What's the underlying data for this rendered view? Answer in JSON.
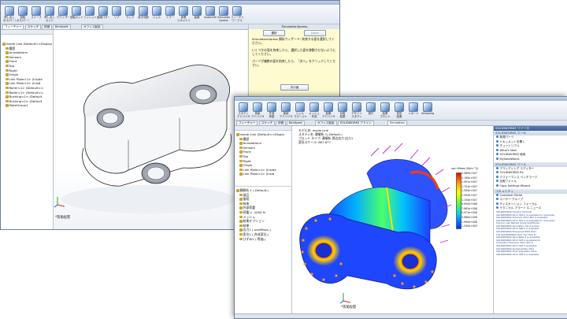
{
  "back_window": {
    "ribbon": [
      {
        "label": "押し出し\nボス/ベース",
        "icon": "extrude-boss-icon"
      },
      {
        "label": "回転\nボス/ベース",
        "icon": "revolve-boss-icon"
      },
      {
        "label": "スイープ",
        "icon": "sweep-icon"
      },
      {
        "label": "押し出し\nカット",
        "icon": "extrude-cut-icon"
      },
      {
        "label": "穴ウィザード",
        "icon": "hole-wizard-icon"
      },
      {
        "label": "回転カット",
        "icon": "revolve-cut-icon"
      },
      {
        "label": "フィレット",
        "icon": "fillet-icon"
      },
      {
        "label": "直線パターン",
        "icon": "linear-pattern-icon"
      },
      {
        "label": "リブ",
        "icon": "rib-icon"
      },
      {
        "label": "ラップ",
        "icon": "wrap-icon"
      },
      {
        "label": "抜き勾配",
        "icon": "draft-icon"
      },
      {
        "label": "シェル",
        "icon": "shell-icon"
      },
      {
        "label": "ミラー",
        "icon": "mirror-icon"
      },
      {
        "label": "参照\nジオメトリ",
        "icon": "ref-geometry-icon"
      },
      {
        "label": "曲線",
        "icon": "curves-icon"
      },
      {
        "label": "Instant3D",
        "icon": "instant3d-icon"
      },
      {
        "label": "Simulation\nXpress",
        "icon": "simxpress-icon"
      },
      {
        "label": "フィーチャー\nワークス",
        "icon": "featureworks-icon"
      }
    ],
    "tabs": [
      "フィーチャー",
      "スケッチ",
      "評価",
      "DimXpert",
      "オフィス製品"
    ],
    "active_tab": 0,
    "tree": [
      "Inside Link (Default<<Display",
      "履歴",
      "Annotations",
      "Sensors",
      "Front",
      "Top",
      "Right",
      "Origin",
      "Link Plate<1> (Inside",
      "Link Plate<2> (Insid",
      "Roller<1> (Default<<",
      "Roller<1> (Default<<",
      "Bushing<1> (Default",
      "Bushing<2> (Default",
      "MateGroup1"
    ],
    "view_label": "*等角投影",
    "task_header": "SimulationXpress",
    "task_tabs": [
      "選択",
      "Done"
    ],
    "task_paragraphs": [
      "SimulationXpress 解析ウィザード: 拘束する面を選択してください。",
      "いくつかの面を拘束したら、選択した面を移動させないようにしてください。",
      "パーツが複数の面を拘束したら、「次へ」をクリックしてください。"
    ],
    "task_button": "次の面"
  },
  "front_window": {
    "ribbon": [
      {
        "label": "スタディ\nアドバイザ",
        "icon": "study-advisor-icon"
      },
      {
        "label": "拘束\nアドバイザ",
        "icon": "fixture-advisor-icon"
      },
      {
        "label": "外部\n荷重",
        "icon": "external-load-icon"
      },
      {
        "label": "接続\nアドバイザ",
        "icon": "connection-icon"
      },
      {
        "label": "シェル\nマネージャ",
        "icon": "shell-manager-icon"
      },
      {
        "label": "メッシュ\n作成",
        "icon": "mesh-icon"
      },
      {
        "label": "結果\nアドバイザ",
        "icon": "results-advisor-icon"
      },
      {
        "label": "比較\n結果",
        "icon": "compare-icon"
      },
      {
        "label": "デザイン\nスタディ",
        "icon": "design-study-icon"
      },
      {
        "label": "実行",
        "icon": "run-icon"
      },
      {
        "label": "結果\nプロット",
        "icon": "plot-icon"
      },
      {
        "label": "変形\n結果",
        "icon": "deformed-icon"
      },
      {
        "label": "レポート",
        "icon": "report-icon"
      },
      {
        "label": "eDrawings",
        "icon": "edrawings-icon"
      }
    ],
    "tabs": [
      "フィーチャー",
      "スケッチ",
      "評価",
      "DimXpert",
      "オフィス製品",
      "SOLIDWORKS アドイン",
      "Simulation"
    ],
    "active_tab": 6,
    "tree": [
      "Inside Link (Default<<Displa",
      "履歴",
      "Annotations",
      "Sensors",
      "Front",
      "Top",
      "Right",
      "Origin",
      "Link Plate<1> (Inside",
      "Link Plate<2> (Insid"
    ],
    "study_tree": [
      "静解析 1 (-Default-)",
      "部品",
      "接続",
      "拘束",
      "外部荷重",
      "荷重-1 :1000 N",
      "メッシュ",
      "結果オプション",
      "結果",
      "応力1 (-vonMises-)",
      "変位1 (-合成変位-)",
      "ひずみ1 (-等価-)"
    ],
    "study_info": [
      "モデル名: Inside Link",
      "スタディ名: 静解析 1(-Default-)",
      "プロット タイプ: 静解析 節点応力 応力1",
      "変形スケール: 867.877"
    ],
    "legend_title": "von Mises (N/m^2)",
    "legend_values": [
      "2.389e+007",
      "2.190e+007",
      "1.991e+007",
      "1.791e+007",
      "1.592e+007",
      "1.393e+007",
      "1.194e+007",
      "9.954e+006",
      "7.962e+006",
      "5.971e+006",
      "3.980e+006",
      "1.990e+006",
      "1.345e+003"
    ],
    "view_label": "*等角投影",
    "task_pane": {
      "header": "SOLIDWORKS リソース",
      "sections": [
        {
          "title": "SOLIDWORKS ツール",
          "items": [
            "新規パーツ",
            "ドキュメントを開く",
            "チュートリアル",
            "What's New",
            "SOLIDWORKS 使用",
            "MySolidWorks"
          ]
        },
        {
          "title": "SOLIDWORKS ツール",
          "items": [
            "ブランディング エディター",
            "SOLIDWORKS Rx",
            "パフォーマンス ベンチマーク",
            "比較ファイル",
            "Copy Settings Wizard"
          ]
        },
        {
          "title": "コミュニティ",
          "items": [
            "Customer Portal",
            "ユーザー グループ",
            "ディスカッション フォーラム",
            "テクニカル アラート & ニュース"
          ]
        }
      ],
      "news": [
        "SOLIDWORKS Training Tutorials",
        "SOLIDWORKS 2011 SP2.0 is available for download",
        "SOLIDWORKS Premium 2011 SP1 is available",
        "SOLIDWORKS 2011 SP1.0 is available for download",
        "Tutorial: Get Started Using SolidWorks",
        "SOLIDWORKS Simulation Service Pack",
        "SOLIDWORKS 2011 SP0.0 is available",
        "SOLIDWORKS Enterprise PDM 2011",
        "The SOLIDWORKS Tech Tip: How to",
        "SOLIDWORKS 2011 Beta 2 is available",
        "SOLIDWORKS 2011 SP3 is available for",
        "Simulation Premium 2011 SP2.0",
        "SOLIDWORKS 2011 SP4 is available",
        "SOLIDWORKS Sustainability 2011",
        "SOLIDWORKS Flow Simulation 2011",
        "SOLIDWORKS 2011 SP5.0 is available"
      ]
    }
  }
}
